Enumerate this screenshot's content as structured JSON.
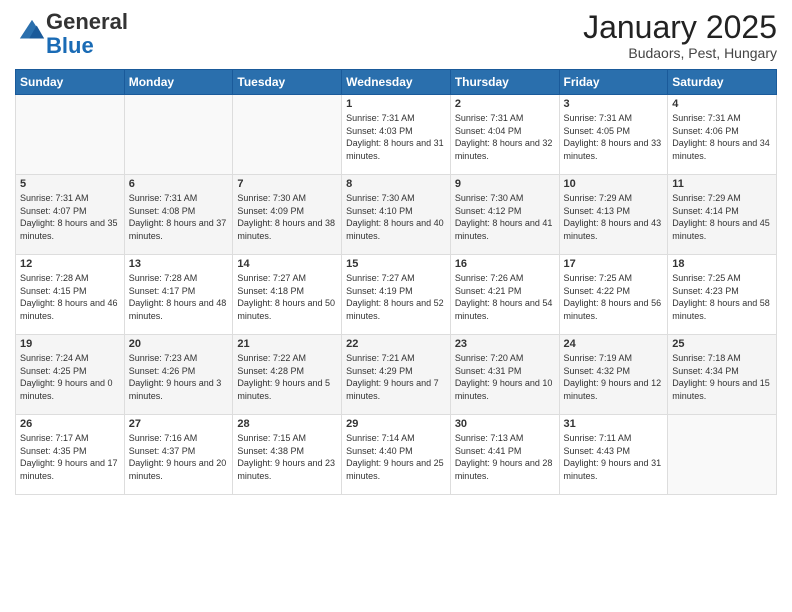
{
  "header": {
    "logo_general": "General",
    "logo_blue": "Blue",
    "month_title": "January 2025",
    "location": "Budaors, Pest, Hungary"
  },
  "weekdays": [
    "Sunday",
    "Monday",
    "Tuesday",
    "Wednesday",
    "Thursday",
    "Friday",
    "Saturday"
  ],
  "weeks": [
    [
      {
        "day": "",
        "info": ""
      },
      {
        "day": "",
        "info": ""
      },
      {
        "day": "",
        "info": ""
      },
      {
        "day": "1",
        "info": "Sunrise: 7:31 AM\nSunset: 4:03 PM\nDaylight: 8 hours and 31 minutes."
      },
      {
        "day": "2",
        "info": "Sunrise: 7:31 AM\nSunset: 4:04 PM\nDaylight: 8 hours and 32 minutes."
      },
      {
        "day": "3",
        "info": "Sunrise: 7:31 AM\nSunset: 4:05 PM\nDaylight: 8 hours and 33 minutes."
      },
      {
        "day": "4",
        "info": "Sunrise: 7:31 AM\nSunset: 4:06 PM\nDaylight: 8 hours and 34 minutes."
      }
    ],
    [
      {
        "day": "5",
        "info": "Sunrise: 7:31 AM\nSunset: 4:07 PM\nDaylight: 8 hours and 35 minutes."
      },
      {
        "day": "6",
        "info": "Sunrise: 7:31 AM\nSunset: 4:08 PM\nDaylight: 8 hours and 37 minutes."
      },
      {
        "day": "7",
        "info": "Sunrise: 7:30 AM\nSunset: 4:09 PM\nDaylight: 8 hours and 38 minutes."
      },
      {
        "day": "8",
        "info": "Sunrise: 7:30 AM\nSunset: 4:10 PM\nDaylight: 8 hours and 40 minutes."
      },
      {
        "day": "9",
        "info": "Sunrise: 7:30 AM\nSunset: 4:12 PM\nDaylight: 8 hours and 41 minutes."
      },
      {
        "day": "10",
        "info": "Sunrise: 7:29 AM\nSunset: 4:13 PM\nDaylight: 8 hours and 43 minutes."
      },
      {
        "day": "11",
        "info": "Sunrise: 7:29 AM\nSunset: 4:14 PM\nDaylight: 8 hours and 45 minutes."
      }
    ],
    [
      {
        "day": "12",
        "info": "Sunrise: 7:28 AM\nSunset: 4:15 PM\nDaylight: 8 hours and 46 minutes."
      },
      {
        "day": "13",
        "info": "Sunrise: 7:28 AM\nSunset: 4:17 PM\nDaylight: 8 hours and 48 minutes."
      },
      {
        "day": "14",
        "info": "Sunrise: 7:27 AM\nSunset: 4:18 PM\nDaylight: 8 hours and 50 minutes."
      },
      {
        "day": "15",
        "info": "Sunrise: 7:27 AM\nSunset: 4:19 PM\nDaylight: 8 hours and 52 minutes."
      },
      {
        "day": "16",
        "info": "Sunrise: 7:26 AM\nSunset: 4:21 PM\nDaylight: 8 hours and 54 minutes."
      },
      {
        "day": "17",
        "info": "Sunrise: 7:25 AM\nSunset: 4:22 PM\nDaylight: 8 hours and 56 minutes."
      },
      {
        "day": "18",
        "info": "Sunrise: 7:25 AM\nSunset: 4:23 PM\nDaylight: 8 hours and 58 minutes."
      }
    ],
    [
      {
        "day": "19",
        "info": "Sunrise: 7:24 AM\nSunset: 4:25 PM\nDaylight: 9 hours and 0 minutes."
      },
      {
        "day": "20",
        "info": "Sunrise: 7:23 AM\nSunset: 4:26 PM\nDaylight: 9 hours and 3 minutes."
      },
      {
        "day": "21",
        "info": "Sunrise: 7:22 AM\nSunset: 4:28 PM\nDaylight: 9 hours and 5 minutes."
      },
      {
        "day": "22",
        "info": "Sunrise: 7:21 AM\nSunset: 4:29 PM\nDaylight: 9 hours and 7 minutes."
      },
      {
        "day": "23",
        "info": "Sunrise: 7:20 AM\nSunset: 4:31 PM\nDaylight: 9 hours and 10 minutes."
      },
      {
        "day": "24",
        "info": "Sunrise: 7:19 AM\nSunset: 4:32 PM\nDaylight: 9 hours and 12 minutes."
      },
      {
        "day": "25",
        "info": "Sunrise: 7:18 AM\nSunset: 4:34 PM\nDaylight: 9 hours and 15 minutes."
      }
    ],
    [
      {
        "day": "26",
        "info": "Sunrise: 7:17 AM\nSunset: 4:35 PM\nDaylight: 9 hours and 17 minutes."
      },
      {
        "day": "27",
        "info": "Sunrise: 7:16 AM\nSunset: 4:37 PM\nDaylight: 9 hours and 20 minutes."
      },
      {
        "day": "28",
        "info": "Sunrise: 7:15 AM\nSunset: 4:38 PM\nDaylight: 9 hours and 23 minutes."
      },
      {
        "day": "29",
        "info": "Sunrise: 7:14 AM\nSunset: 4:40 PM\nDaylight: 9 hours and 25 minutes."
      },
      {
        "day": "30",
        "info": "Sunrise: 7:13 AM\nSunset: 4:41 PM\nDaylight: 9 hours and 28 minutes."
      },
      {
        "day": "31",
        "info": "Sunrise: 7:11 AM\nSunset: 4:43 PM\nDaylight: 9 hours and 31 minutes."
      },
      {
        "day": "",
        "info": ""
      }
    ]
  ]
}
